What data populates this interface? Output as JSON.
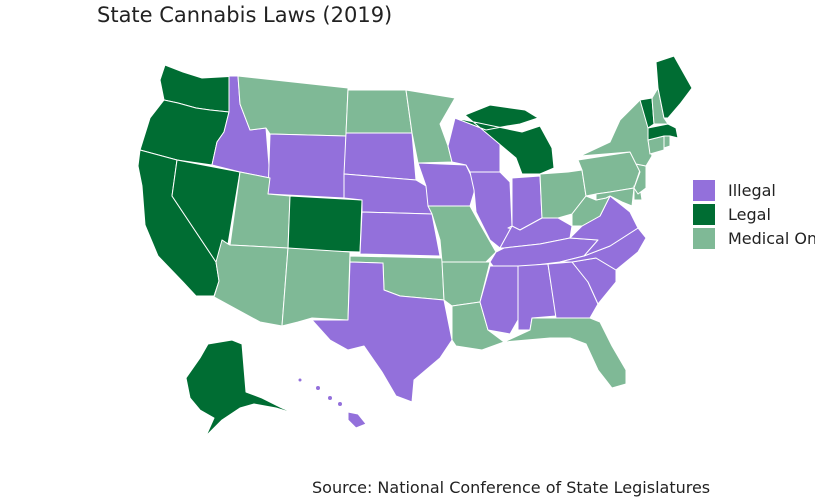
{
  "title": "State Cannabis Laws (2019)",
  "caption": "Source: National Conference of State Legislatures",
  "legend": [
    {
      "key": "illegal",
      "label": "Illegal",
      "color": "#9370DB"
    },
    {
      "key": "legal",
      "label": "Legal",
      "color": "#006D33"
    },
    {
      "key": "medical",
      "label": "Medical Only",
      "color": "#7FB996"
    }
  ],
  "states": [
    {
      "name": "Washington",
      "status": "legal"
    },
    {
      "name": "Oregon",
      "status": "legal"
    },
    {
      "name": "California",
      "status": "legal"
    },
    {
      "name": "Nevada",
      "status": "legal"
    },
    {
      "name": "Idaho",
      "status": "illegal"
    },
    {
      "name": "Montana",
      "status": "medical"
    },
    {
      "name": "Wyoming",
      "status": "illegal"
    },
    {
      "name": "Utah",
      "status": "medical"
    },
    {
      "name": "Colorado",
      "status": "legal"
    },
    {
      "name": "Arizona",
      "status": "medical"
    },
    {
      "name": "New Mexico",
      "status": "medical"
    },
    {
      "name": "North Dakota",
      "status": "medical"
    },
    {
      "name": "South Dakota",
      "status": "illegal"
    },
    {
      "name": "Nebraska",
      "status": "illegal"
    },
    {
      "name": "Kansas",
      "status": "illegal"
    },
    {
      "name": "Oklahoma",
      "status": "medical"
    },
    {
      "name": "Texas",
      "status": "illegal"
    },
    {
      "name": "Minnesota",
      "status": "medical"
    },
    {
      "name": "Iowa",
      "status": "illegal"
    },
    {
      "name": "Missouri",
      "status": "medical"
    },
    {
      "name": "Arkansas",
      "status": "medical"
    },
    {
      "name": "Louisiana",
      "status": "medical"
    },
    {
      "name": "Wisconsin",
      "status": "illegal"
    },
    {
      "name": "Illinois",
      "status": "illegal"
    },
    {
      "name": "Michigan",
      "status": "legal"
    },
    {
      "name": "Indiana",
      "status": "illegal"
    },
    {
      "name": "Ohio",
      "status": "medical"
    },
    {
      "name": "Kentucky",
      "status": "illegal"
    },
    {
      "name": "Tennessee",
      "status": "illegal"
    },
    {
      "name": "Mississippi",
      "status": "illegal"
    },
    {
      "name": "Alabama",
      "status": "illegal"
    },
    {
      "name": "Georgia",
      "status": "illegal"
    },
    {
      "name": "Florida",
      "status": "medical"
    },
    {
      "name": "South Carolina",
      "status": "illegal"
    },
    {
      "name": "North Carolina",
      "status": "illegal"
    },
    {
      "name": "Virginia",
      "status": "illegal"
    },
    {
      "name": "West Virginia",
      "status": "medical"
    },
    {
      "name": "Maryland",
      "status": "medical"
    },
    {
      "name": "Delaware",
      "status": "medical"
    },
    {
      "name": "Pennsylvania",
      "status": "medical"
    },
    {
      "name": "New Jersey",
      "status": "medical"
    },
    {
      "name": "New York",
      "status": "medical"
    },
    {
      "name": "Connecticut",
      "status": "medical"
    },
    {
      "name": "Rhode Island",
      "status": "medical"
    },
    {
      "name": "Massachusetts",
      "status": "legal"
    },
    {
      "name": "Vermont",
      "status": "legal"
    },
    {
      "name": "New Hampshire",
      "status": "medical"
    },
    {
      "name": "Maine",
      "status": "legal"
    },
    {
      "name": "Alaska",
      "status": "legal"
    },
    {
      "name": "Hawaii",
      "status": "illegal"
    }
  ]
}
